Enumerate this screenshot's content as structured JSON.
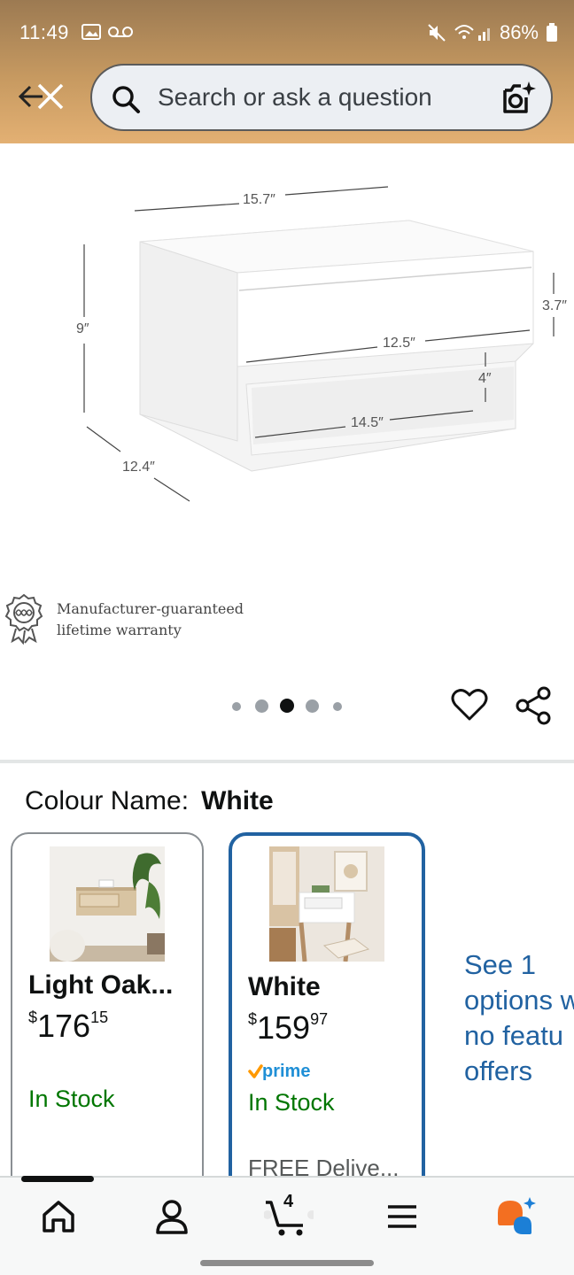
{
  "status_bar": {
    "time": "11:49",
    "battery": "86%"
  },
  "search": {
    "placeholder": "Search or ask a question"
  },
  "product_image": {
    "dimensions": {
      "top_width": "15.7″",
      "height": "9″",
      "drawer_height": "3.7″",
      "drawer_width": "12.5″",
      "shelf_height": "4″",
      "shelf_width": "14.5″",
      "depth": "12.4″"
    }
  },
  "warranty": {
    "text": "Manufacturer-guaranteed\nlifetime warranty"
  },
  "carousel": {
    "dot_count": 5,
    "active_index": 2
  },
  "colour": {
    "label": "Colour Name:",
    "value": "White"
  },
  "options": [
    {
      "title": "Light Oak...",
      "price_currency": "$",
      "price_whole": "176",
      "price_fraction": "15",
      "stock": "In Stock",
      "selected": false
    },
    {
      "title": "White",
      "price_currency": "$",
      "price_whole": "159",
      "price_fraction": "97",
      "prime": "prime",
      "stock": "In Stock",
      "delivery": "FREE Delive...",
      "selected": true
    }
  ],
  "see_options": {
    "lines": [
      "See 1",
      "options w",
      "no featu",
      "offers"
    ]
  },
  "tabbar": {
    "cart_count": "4"
  },
  "colors": {
    "link": "#2162a1",
    "in_stock": "#007600",
    "prime_check": "#ff9900",
    "selected_border": "#2162a1"
  }
}
